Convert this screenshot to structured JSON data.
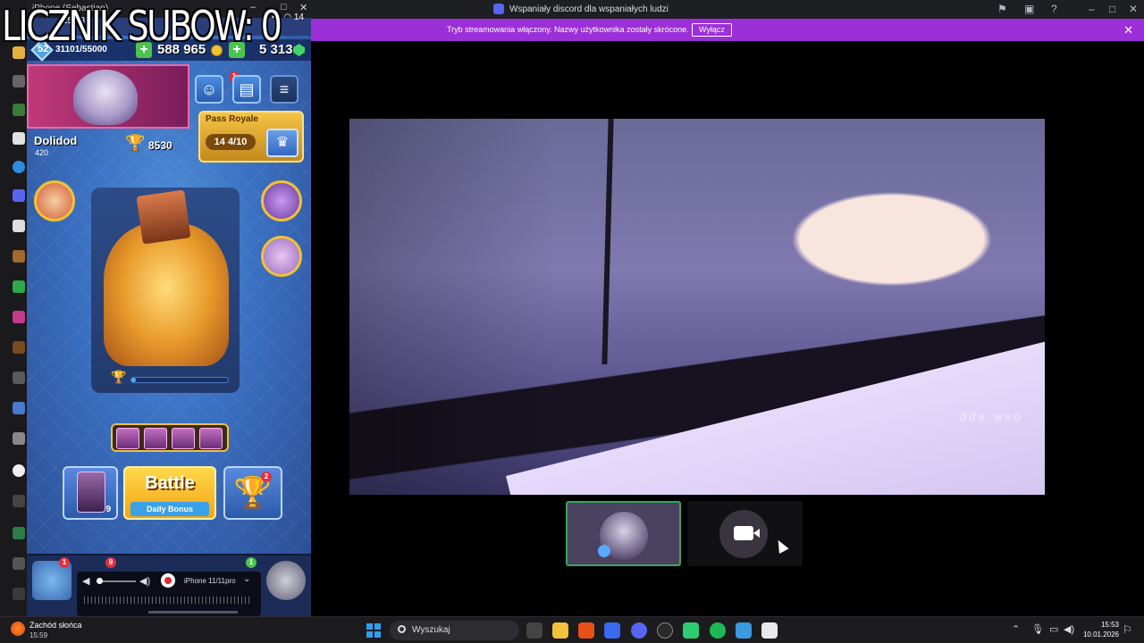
{
  "overlay": {
    "subs_text": "LICZNIK SUBOW: 0"
  },
  "phone": {
    "window_title": "iPhone (Sebastian)",
    "status_clock": "15:53",
    "battery": "14",
    "game": {
      "level": "52",
      "xp": "31101/55000",
      "gold": "588 965",
      "gems": "5 313",
      "player_name": "Dolidod",
      "player_sub": "420",
      "trophies": "8530",
      "pass_royale": {
        "label": "Pass Royale",
        "tier": "14",
        "progress": "4/10"
      },
      "battle_label": "Battle",
      "daily_bonus_label": "Daily Bonus",
      "deck_level": "9",
      "trophy_road_notif": "2",
      "social_notif": "1",
      "nav_notifs": [
        "1",
        "9",
        "1"
      ],
      "arena_progress_fraction": 0.05
    },
    "audio": {
      "device": "iPhone 11/11pro"
    }
  },
  "discord": {
    "title": "Wspaniały discord dla wspaniałych ludzi",
    "notice": "Tryb streamowania włączony. Nazwy użytkownika zostały skrócone.",
    "notice_button": "Wyłącz",
    "stream_watermark": "ddə·weo",
    "accent": "#9b2fd8",
    "speaking_color": "#3ba55d"
  },
  "taskbar": {
    "weather_label": "Zachód słońca",
    "weather_time": "15:59",
    "search_placeholder": "Wyszukaj",
    "time": "15:53",
    "date": "10.01.2026",
    "apps": [
      "task-view-icon",
      "file-explorer-icon",
      "brave-icon",
      "arc-browser-icon",
      "discord-icon",
      "chatgpt-icon",
      "android-mirror-icon",
      "spotify-icon",
      "photos-icon",
      "notepad-icon"
    ]
  }
}
